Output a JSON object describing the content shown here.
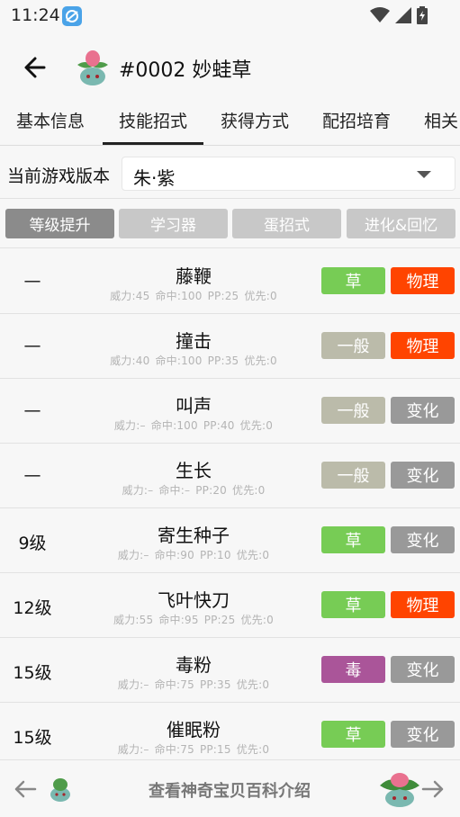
{
  "status_bar": {
    "time": "11:24"
  },
  "header": {
    "title": "#0002 妙蛙草"
  },
  "tabs": [
    {
      "label": "基本信息",
      "active": false
    },
    {
      "label": "技能招式",
      "active": true
    },
    {
      "label": "获得方式",
      "active": false
    },
    {
      "label": "配招培育",
      "active": false
    },
    {
      "label": "相关",
      "active": false
    }
  ],
  "version": {
    "label": "当前游戏版本",
    "value": "朱·紫"
  },
  "filters": [
    {
      "label": "等级提升",
      "active": true
    },
    {
      "label": "学习器",
      "active": false
    },
    {
      "label": "蛋招式",
      "active": false
    },
    {
      "label": "进化&回忆",
      "active": false
    }
  ],
  "colors": {
    "grass": "#77cc55",
    "normal": "#bbbbaa",
    "poison": "#aa5599",
    "physical": "#ff4400",
    "status": "#999999"
  },
  "moves": [
    {
      "level": "—",
      "name": "藤鞭",
      "power": "威力:45",
      "accuracy": "命中:100",
      "pp": "PP:25",
      "priority": "优先:0",
      "type": "草",
      "type_color": "#77cc55",
      "category": "物理",
      "category_color": "#ff4400"
    },
    {
      "level": "—",
      "name": "撞击",
      "power": "威力:40",
      "accuracy": "命中:100",
      "pp": "PP:35",
      "priority": "优先:0",
      "type": "一般",
      "type_color": "#bbbbaa",
      "category": "物理",
      "category_color": "#ff4400"
    },
    {
      "level": "—",
      "name": "叫声",
      "power": "威力:–",
      "accuracy": "命中:100",
      "pp": "PP:40",
      "priority": "优先:0",
      "type": "一般",
      "type_color": "#bbbbaa",
      "category": "变化",
      "category_color": "#999999"
    },
    {
      "level": "—",
      "name": "生长",
      "power": "威力:–",
      "accuracy": "命中:–",
      "pp": "PP:20",
      "priority": "优先:0",
      "type": "一般",
      "type_color": "#bbbbaa",
      "category": "变化",
      "category_color": "#999999"
    },
    {
      "level": "9级",
      "name": "寄生种子",
      "power": "威力:–",
      "accuracy": "命中:90",
      "pp": "PP:10",
      "priority": "优先:0",
      "type": "草",
      "type_color": "#77cc55",
      "category": "变化",
      "category_color": "#999999"
    },
    {
      "level": "12级",
      "name": "飞叶快刀",
      "power": "威力:55",
      "accuracy": "命中:95",
      "pp": "PP:25",
      "priority": "优先:0",
      "type": "草",
      "type_color": "#77cc55",
      "category": "物理",
      "category_color": "#ff4400"
    },
    {
      "level": "15级",
      "name": "毒粉",
      "power": "威力:–",
      "accuracy": "命中:75",
      "pp": "PP:35",
      "priority": "优先:0",
      "type": "毒",
      "type_color": "#aa5599",
      "category": "变化",
      "category_color": "#999999"
    },
    {
      "level": "15级",
      "name": "催眠粉",
      "power": "威力:–",
      "accuracy": "命中:75",
      "pp": "PP:15",
      "priority": "优先:0",
      "type": "草",
      "type_color": "#77cc55",
      "category": "变化",
      "category_color": "#999999"
    }
  ],
  "bottom": {
    "link": "查看神奇宝贝百科介绍"
  }
}
